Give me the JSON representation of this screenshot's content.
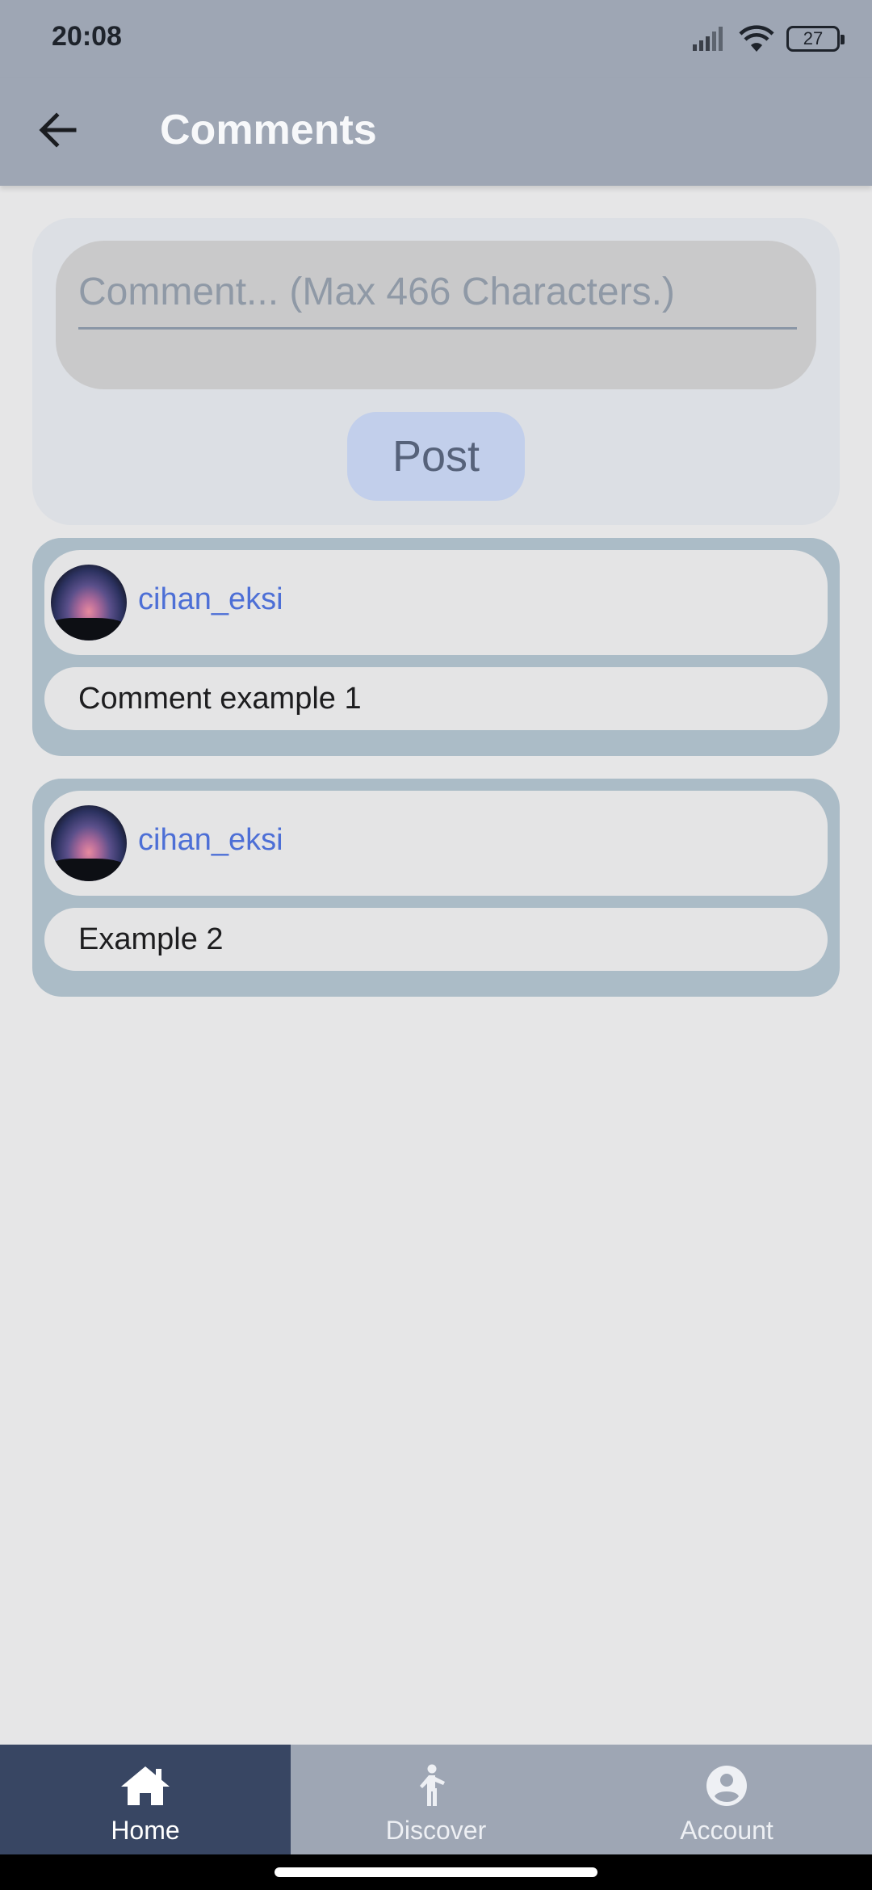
{
  "status_bar": {
    "time": "20:08",
    "battery": "27"
  },
  "header": {
    "title": "Comments"
  },
  "compose": {
    "placeholder": "Comment... (Max 466 Characters.)",
    "post_label": "Post"
  },
  "comments": [
    {
      "username": "cihan_eksi",
      "text": "Comment example 1"
    },
    {
      "username": "cihan_eksi",
      "text": "Example 2"
    }
  ],
  "bottom_nav": {
    "items": [
      {
        "label": "Home",
        "icon": "home-icon",
        "active": true
      },
      {
        "label": "Discover",
        "icon": "person-walking-icon",
        "active": false
      },
      {
        "label": "Account",
        "icon": "account-circle-icon",
        "active": false
      }
    ]
  },
  "colors": {
    "app_bar": "#9ea6b4",
    "nav_active": "#384663",
    "username": "#4d6fd6",
    "post_button": "#c2cfeb",
    "comment_card": "#abbcc7"
  }
}
